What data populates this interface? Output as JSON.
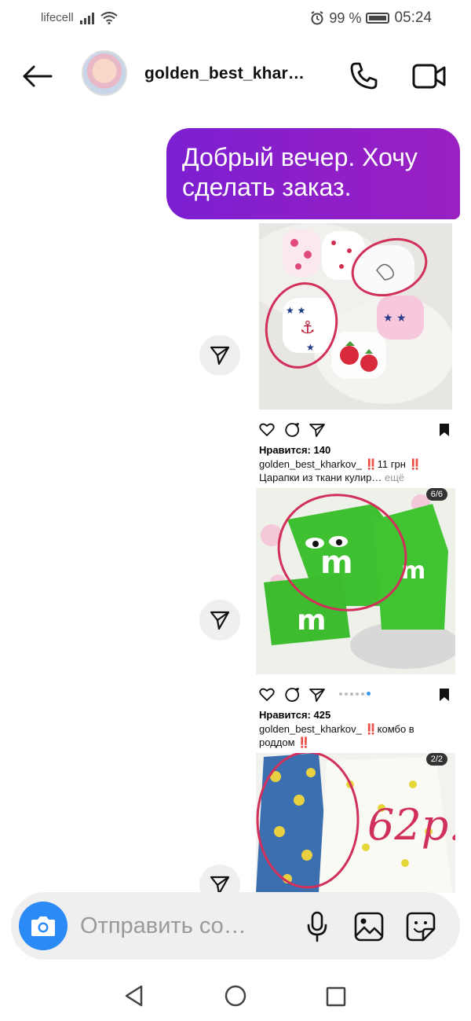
{
  "status_bar": {
    "carrier": "lifecell",
    "battery_percent": "99 %",
    "time": "05:24"
  },
  "header": {
    "title": "golden_best_khar…"
  },
  "messages": {
    "outgoing_text": "Добрый вечер. Хочу сделать заказ."
  },
  "posts": [
    {
      "likes": "Нравится: 140",
      "username": "golden_best_kharkov_",
      "caption_line1": "‼️11 грн ‼️",
      "caption_line2": "Царапки из ткани кулир…",
      "more": "ещё"
    },
    {
      "counter": "6/6",
      "likes": "Нравится: 425",
      "username": "golden_best_kharkov_",
      "caption_line1": "‼️комбо в",
      "caption_line2": "роддом ‼️"
    },
    {
      "counter": "2/2",
      "overlay_text": "62р."
    }
  ],
  "composer": {
    "placeholder": "Отправить со…"
  },
  "colors": {
    "bubble_start": "#7b1fd1",
    "bubble_end": "#9a20c2",
    "camera": "#2a8af6",
    "carousel_active_dot": "#3897f0",
    "annotation_circle": "#d0305a"
  }
}
